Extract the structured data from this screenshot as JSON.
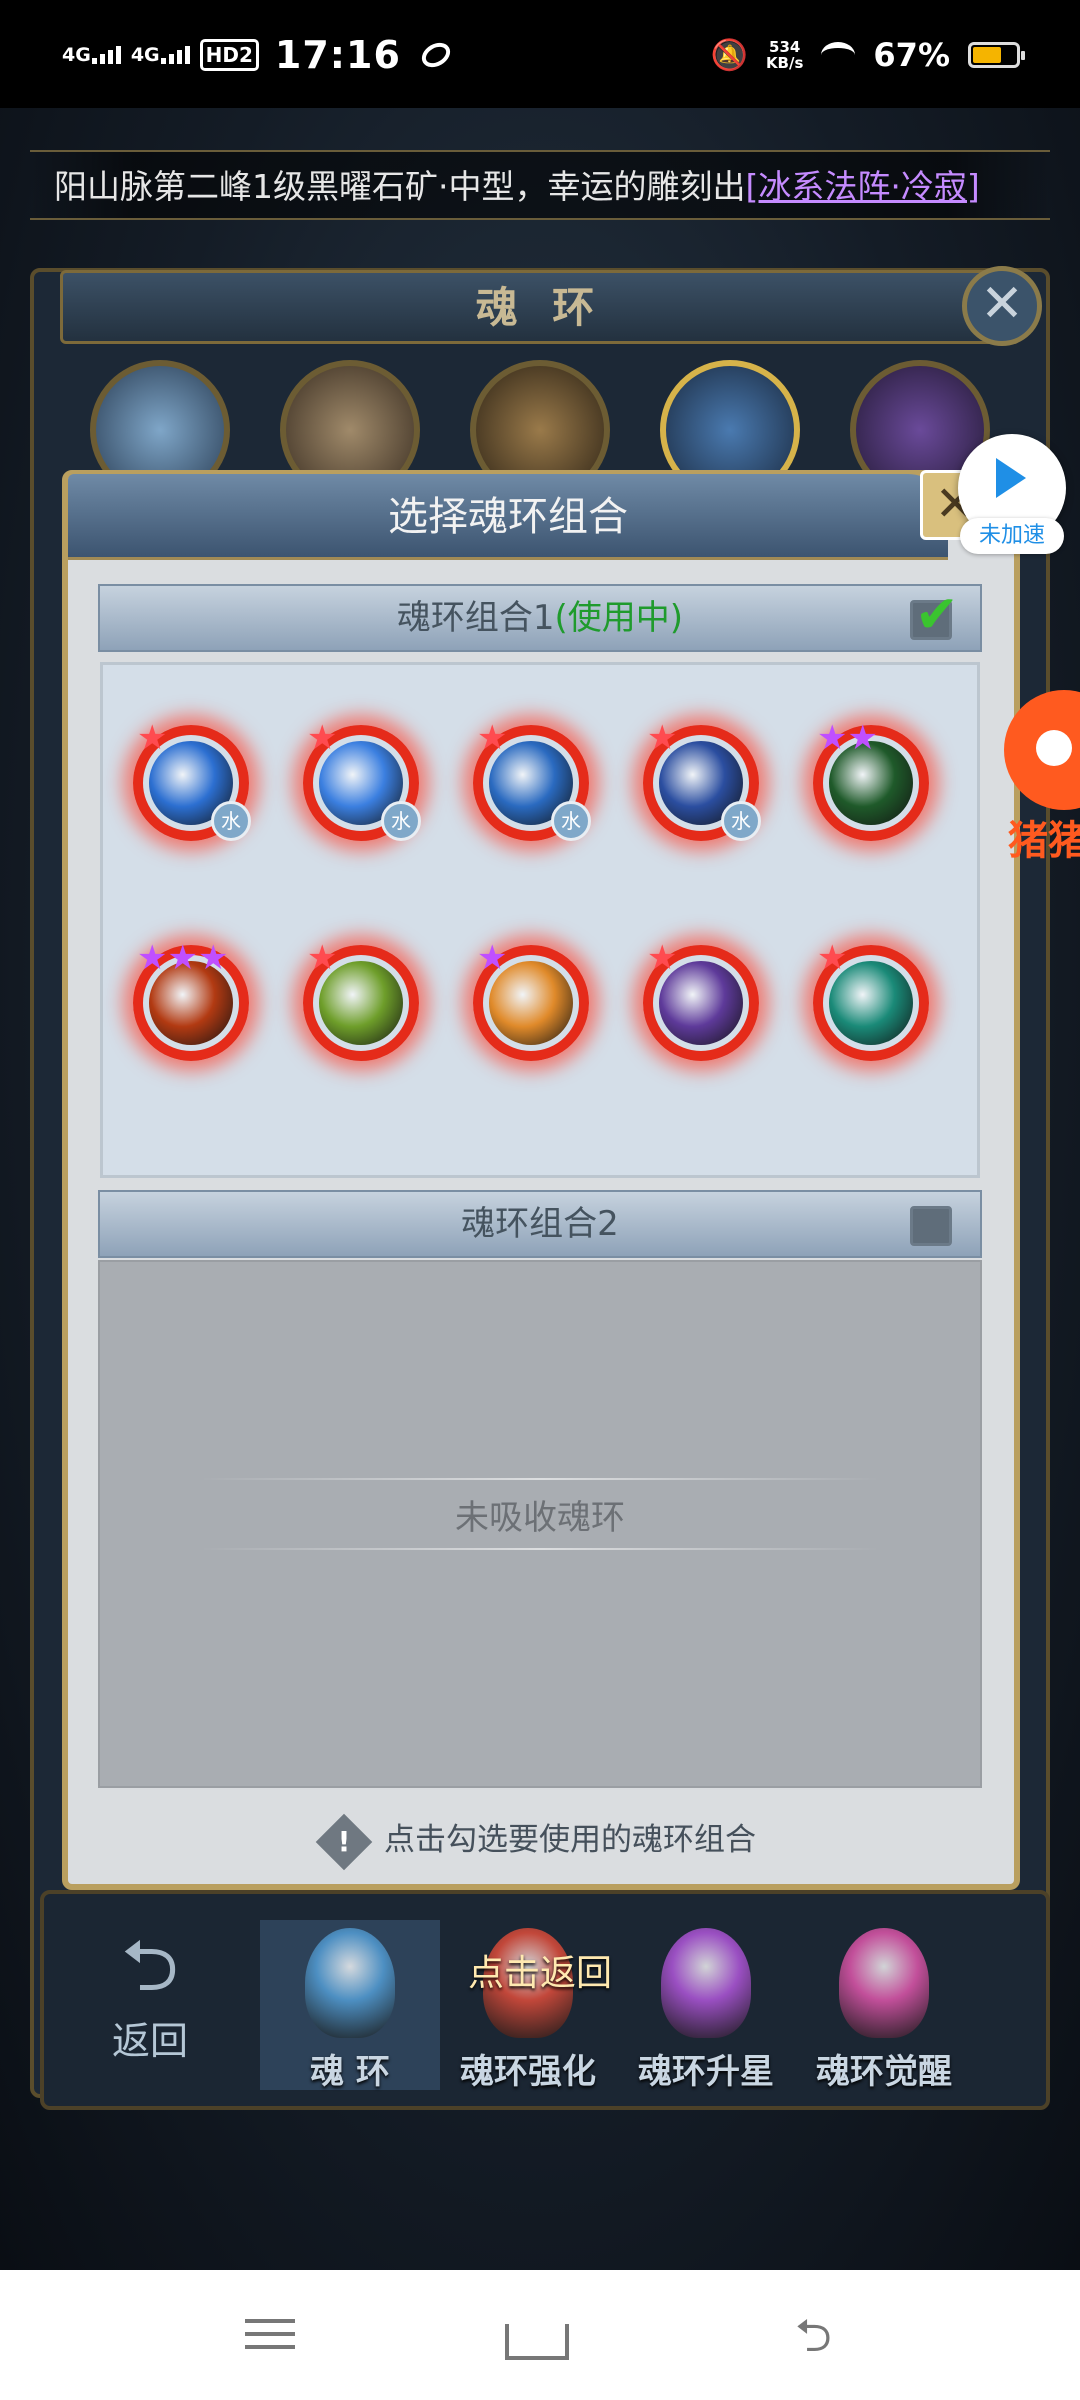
{
  "status_bar": {
    "net1": "4G",
    "net2": "4G",
    "hd": "HD2",
    "time": "17:16",
    "speed_value": "534",
    "speed_unit": "KB/s",
    "battery_pct": "67%",
    "battery_level": 0.67
  },
  "marquee": {
    "text": "阳山脉第二峰1级黑曜石矿·中型，幸运的雕刻出",
    "highlight": "[冰系法阵·冷寂]"
  },
  "panel": {
    "title": "魂 环",
    "close": "✕"
  },
  "modal": {
    "title": "选择魂环组合",
    "close": "✕",
    "group1": {
      "label": "魂环组合1",
      "status": "(使用中)",
      "checked": true
    },
    "group2": {
      "label": "魂环组合2",
      "checked": false
    },
    "empty_text": "未吸收魂环",
    "hint": "点击勾选要使用的魂环组合"
  },
  "rings": [
    {
      "stars": "★",
      "star_color": "#ff4b50",
      "core": "#2c6fd1",
      "badge": "水",
      "icon": "water-dragon-ring-icon"
    },
    {
      "stars": "★",
      "star_color": "#ff4b50",
      "core": "#3b7fe0",
      "badge": "水",
      "icon": "vortex-ring-icon"
    },
    {
      "stars": "★",
      "star_color": "#ff4b50",
      "core": "#2a6ac0",
      "badge": "水",
      "icon": "wave-ring-icon"
    },
    {
      "stars": "★",
      "star_color": "#ff4b50",
      "core": "#2b4ea0",
      "badge": "水",
      "icon": "ice-beast-ring-icon"
    },
    {
      "stars": "★★",
      "star_color": "#c04fff",
      "core": "#1f5a2a",
      "badge": "",
      "icon": "forest-spirit-ring-icon"
    },
    {
      "stars": "★★★",
      "star_color": "#c04fff",
      "core": "#b23a12",
      "badge": "",
      "icon": "fire-beast-ring-icon"
    },
    {
      "stars": "★",
      "star_color": "#ff4b50",
      "core": "#6e9e2a",
      "badge": "",
      "icon": "wind-bird-ring-icon"
    },
    {
      "stars": "★",
      "star_color": "#c04fff",
      "core": "#e08a2a",
      "badge": "",
      "icon": "golden-beast-ring-icon"
    },
    {
      "stars": "★",
      "star_color": "#ff4b50",
      "core": "#5e3a9a",
      "badge": "",
      "icon": "shadow-dragon-ring-icon"
    },
    {
      "stars": "★",
      "star_color": "#ff4b50",
      "core": "#1a8a78",
      "badge": "",
      "icon": "jade-spirit-ring-icon"
    }
  ],
  "bottom_tabs": {
    "back": "返回",
    "return_hint": "点击返回",
    "tabs": [
      {
        "label": "魂 环",
        "gem": "#4d8fc2"
      },
      {
        "label": "魂环强化",
        "gem": "#c2473a"
      },
      {
        "label": "魂环升星",
        "gem": "#9a4fc2"
      },
      {
        "label": "魂环觉醒",
        "gem": "#c24f9a"
      }
    ]
  },
  "float": {
    "speed_label": "未加速",
    "pig_text": "猪猪"
  },
  "colors": {
    "accent_gold": "#b99f5f",
    "in_use_green": "#1f9b2d",
    "ring_red": "#e52b1a"
  }
}
